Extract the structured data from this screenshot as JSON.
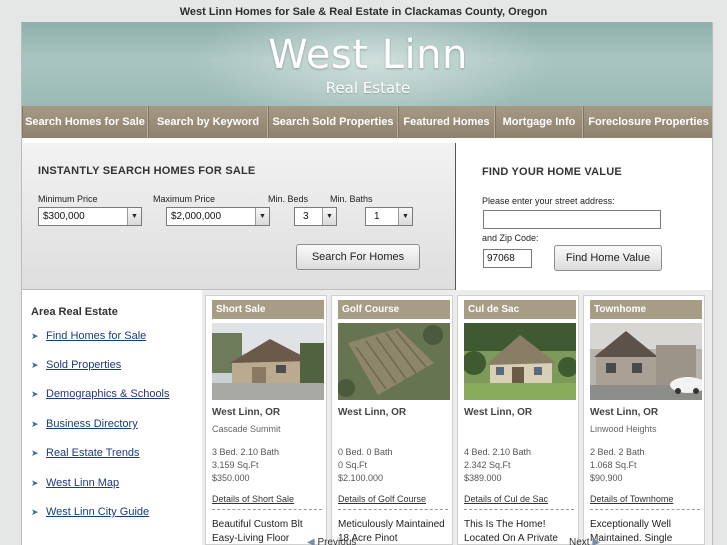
{
  "page_title": "West Linn Homes for Sale & Real Estate in Clackamas County, Oregon",
  "brand": {
    "name": "West Linn",
    "subtitle": "Real Estate"
  },
  "nav": [
    "Search Homes for Sale",
    "Search by Keyword",
    "Search Sold Properties",
    "Featured Homes",
    "Mortgage Info",
    "Foreclosure Properties"
  ],
  "search": {
    "heading": "INSTANTLY SEARCH HOMES FOR SALE",
    "min_price_label": "Minimum Price",
    "min_price_value": "$300,000",
    "max_price_label": "Maximum Price",
    "max_price_value": "$2,000,000",
    "min_beds_label": "Min. Beds",
    "min_beds_value": "3",
    "min_baths_label": "Min. Baths",
    "min_baths_value": "1",
    "button": "Search For Homes"
  },
  "home_value": {
    "heading": "FIND YOUR HOME VALUE",
    "address_label": "Please enter your street address:",
    "address_value": "",
    "zip_label": "and Zip Code:",
    "zip_value": "97068",
    "button": "Find Home Value"
  },
  "sidebar": {
    "title": "Area Real Estate",
    "links": [
      "Find Homes for Sale",
      "Sold Properties",
      "Demographics & Schools",
      "Business Directory",
      "Real Estate Trends",
      "West Linn Map",
      "West Linn City Guide"
    ]
  },
  "listings": [
    {
      "type": "Short Sale",
      "location": "West Linn, OR",
      "subdivision": "Cascade Summit",
      "beds_baths": "3 Bed. 2.10 Bath",
      "sqft": "3.159 Sq.Ft",
      "price": "$350.000",
      "details": "Details of Short Sale",
      "desc1": "Beautiful Custom Blt",
      "desc2": "Easy-Living Floor"
    },
    {
      "type": "Golf Course",
      "location": "West Linn, OR",
      "subdivision": "",
      "beds_baths": "0 Bed. 0 Bath",
      "sqft": "0 Sq.Ft",
      "price": "$2.100.000",
      "details": "Details of Golf Course",
      "desc1": "Meticulously Maintained",
      "desc2": "18 Acre Pinot"
    },
    {
      "type": "Cul de Sac",
      "location": "West Linn, OR",
      "subdivision": "",
      "beds_baths": "4 Bed. 2.10 Bath",
      "sqft": "2.342 Sq.Ft",
      "price": "$389.000",
      "details": "Details of Cul de Sac",
      "desc1": "This Is The Home!",
      "desc2": "Located On A Private"
    },
    {
      "type": "Townhome",
      "location": "West Linn, OR",
      "subdivision": "Linwood Heights",
      "beds_baths": "2 Bed. 2 Bath",
      "sqft": "1.068 Sq.Ft",
      "price": "$90.900",
      "details": "Details of Townhome",
      "desc1": "Exceptionally Well",
      "desc2": "Maintained. Single"
    }
  ],
  "pager": {
    "previous": "Previous",
    "next": "Next"
  },
  "colors": {
    "banner": "#9bbab5",
    "nav": "#9a8e7a",
    "card_header": "#a79d86",
    "link": "#1d3a7a"
  }
}
